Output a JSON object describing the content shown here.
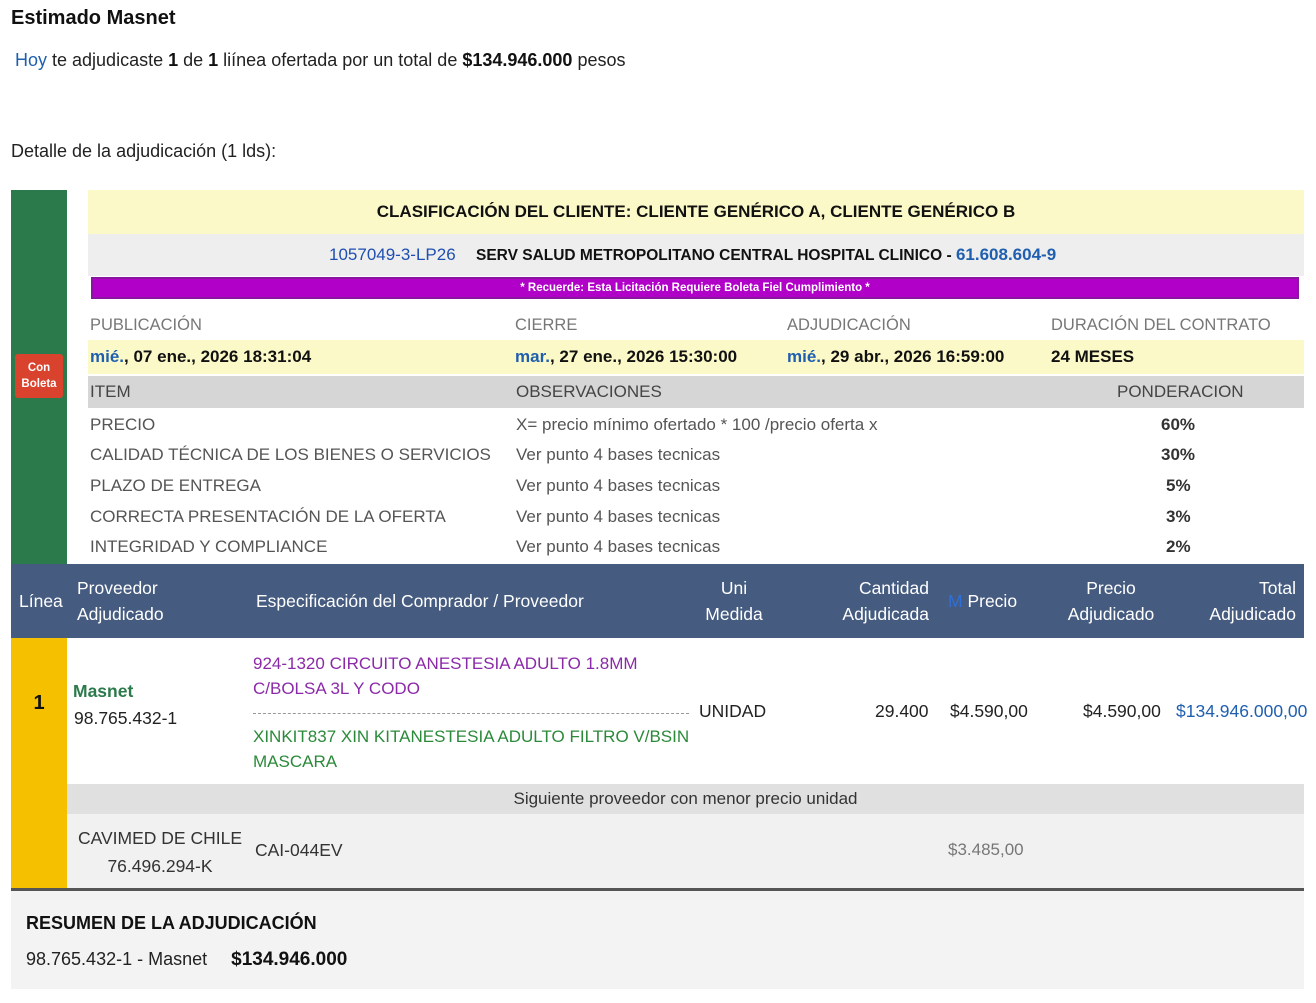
{
  "greeting": "Estimado Masnet",
  "summary": {
    "hoy": "Hoy",
    "text1": " te adjudicaste ",
    "count": "1",
    "text2": " de ",
    "total_lines": "1",
    "text3": " liínea ofertada por un total de ",
    "amount": "$134.946.000",
    "text4": " pesos"
  },
  "detail_heading": "Detalle de la adjudicación (1 lds):",
  "badge": {
    "line1": "Con",
    "line2": "Boleta",
    "color": "#d9432d"
  },
  "tender": {
    "clasificacion": "CLASIFICACIÓN DEL CLIENTE: CLIENTE GENÉRICO A, CLIENTE GENÉRICO B",
    "code": "1057049-3-LP26",
    "organization": "SERV SALUD METROPOLITANO CENTRAL HOSPITAL CLINICO",
    "separator": " - ",
    "org_rut": "61.608.604-9",
    "notice": "* Recuerde: Esta Licitación Requiere Boleta Fiel Cumplimiento *"
  },
  "dates": {
    "labels": {
      "publicacion": "PUBLICACIÓN",
      "cierre": "CIERRE",
      "adjudicacion": "ADJUDICACIÓN",
      "duracion": "DURACIÓN DEL CONTRATO"
    },
    "publicacion": {
      "day": "mié.",
      "rest": ", 07 ene., 2026 18:31:04"
    },
    "cierre": {
      "day": "mar.",
      "rest": ", 27 ene., 2026 15:30:00"
    },
    "adjudicacion": {
      "day": "mié.",
      "rest": ", 29 abr., 2026 16:59:00"
    },
    "duracion": "24 MESES"
  },
  "criteria": {
    "headers": {
      "item": "ITEM",
      "observaciones": "OBSERVACIONES",
      "ponderacion": "PONDERACION"
    },
    "rows": [
      {
        "item": "PRECIO",
        "obs": "X= precio mínimo ofertado * 100 /precio oferta x",
        "pond": "60%"
      },
      {
        "item": "CALIDAD TÉCNICA DE LOS BIENES O SERVICIOS",
        "obs": "Ver punto 4 bases tecnicas",
        "pond": "30%"
      },
      {
        "item": "PLAZO DE ENTREGA",
        "obs": "Ver punto 4 bases tecnicas",
        "pond": "5%"
      },
      {
        "item": "CORRECTA PRESENTACIÓN DE LA OFERTA",
        "obs": "Ver punto 4 bases tecnicas",
        "pond": "3%"
      },
      {
        "item": "INTEGRIDAD Y COMPLIANCE",
        "obs": "Ver punto 4 bases tecnicas",
        "pond": "2%"
      }
    ]
  },
  "table": {
    "headers": {
      "linea": "Línea",
      "proveedor_1": "Proveedor",
      "proveedor_2": "Adjudicado",
      "especificacion": "Especificación del Comprador / Proveedor",
      "unidad_1": "Uni",
      "unidad_2": "Medida",
      "cantidad_1": "Cantidad",
      "cantidad_2": "Adjudicada",
      "precio_marker": "M",
      "precio": "Precio",
      "precio_adj_1": "Precio",
      "precio_adj_2": "Adjudicado",
      "total_1": "Total",
      "total_2": "Adjudicado"
    },
    "row": {
      "linea": "1",
      "proveedor": "Masnet",
      "proveedor_rut": "98.765.432-1",
      "spec_buyer": "924-1320 CIRCUITO ANESTESIA ADULTO 1.8MM C/BOLSA 3L Y CODO",
      "spec_provider": "XINKIT837 XIN KITANESTESIA ADULTO FILTRO V/BSIN MASCARA",
      "unidad": "UNIDAD",
      "cantidad": "29.400",
      "precio": "$4.590,00",
      "precio_adjudicado": "$4.590,00",
      "total": "$134.946.000,00"
    },
    "next_label": "Siguiente proveedor con menor precio unidad",
    "next": {
      "name": "CAVIMED DE CHILE",
      "rut": "76.496.294-K",
      "code": "CAI-044EV",
      "precio": "$3.485,00"
    }
  },
  "resumen": {
    "title": "RESUMEN DE LA ADJUDICACIÓN",
    "line": "98.765.432-1 - Masnet",
    "amount": "$134.946.000"
  }
}
